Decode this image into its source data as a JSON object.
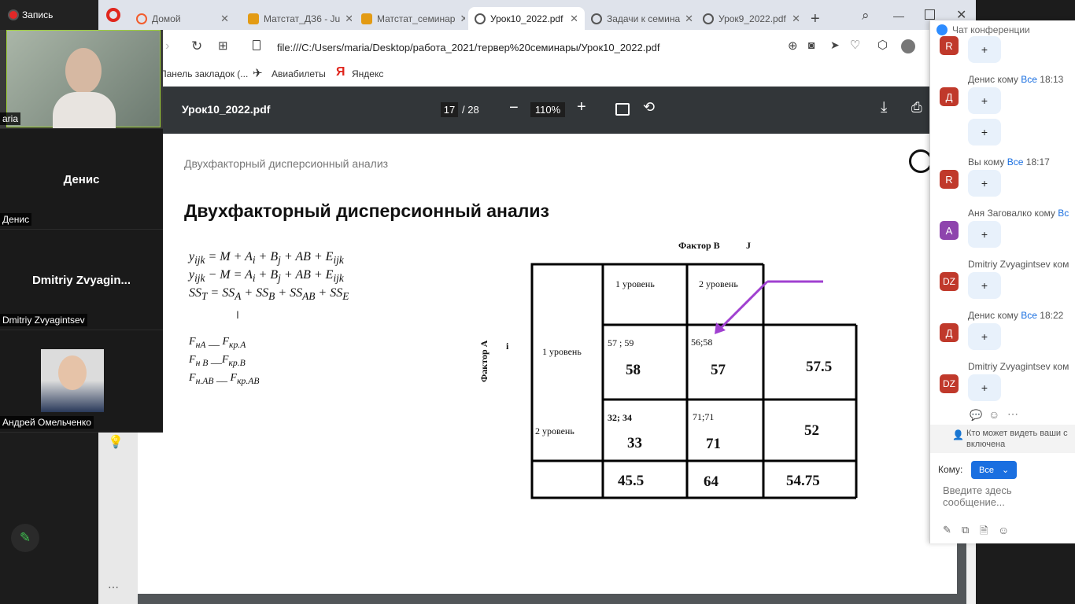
{
  "zoom": {
    "recording_label": "Запись",
    "participants": [
      {
        "name": "aria",
        "display": ""
      },
      {
        "name": "Денис",
        "display": "Денис"
      },
      {
        "name": "Dmitriy Zvyagintsev",
        "display": "Dmitriy  Zvyagin..."
      },
      {
        "name": "Андрей Омельченко",
        "display": ""
      }
    ]
  },
  "browser": {
    "tabs": [
      {
        "label": "Домой",
        "icon": "opera-icon"
      },
      {
        "label": "Матстат_ДЗ6 - Ju",
        "icon": "notebook-icon"
      },
      {
        "label": "Матстат_семинар",
        "icon": "notebook-icon"
      },
      {
        "label": "Урок10_2022.pdf",
        "icon": "globe-icon"
      },
      {
        "label": "Задачи к семина",
        "icon": "globe-icon"
      },
      {
        "label": "Урок9_2022.pdf",
        "icon": "globe-icon"
      }
    ],
    "url": "file:///C:/Users/maria/Desktop/работа_2021/тервер%20семинары/Урок10_2022.pdf",
    "bookmarks": [
      "Панель закладок (...",
      "Авиабилеты",
      "Яндекс"
    ]
  },
  "pdf": {
    "filename": "Урок10_2022.pdf",
    "page_current": "17",
    "page_total": "/ 28",
    "zoom": "110%"
  },
  "slide": {
    "subtitle": "Двухфакторный дисперсионный анализ",
    "title": "Двухфакторный дисперсионный анализ",
    "table": {
      "factor_b": "Фактор В",
      "factor_b_index": "J",
      "factor_a": "Фактор А",
      "factor_a_index": "i",
      "col1": "1 уровень",
      "col2": "2 уровень",
      "row1": "1 уровень",
      "row2": "2 уровень",
      "c11_small": "57 ; 59",
      "c11_big": "58",
      "c12_small": "56;58",
      "c12_big": "57",
      "r1_mean": "57.5",
      "c21_small": "32; 34",
      "c21_big": "33",
      "c22_small": "71;71",
      "c22_big": "71",
      "r2_mean": "52",
      "col1_mean": "45.5",
      "col2_mean": "64",
      "grand_mean": "54.75"
    }
  },
  "chat": {
    "title": "Чат конференции",
    "messages": [
      {
        "avatar": "R",
        "color": "#c0392b",
        "sender": "",
        "to": "",
        "time": "",
        "bubbles": [
          "+"
        ]
      },
      {
        "avatar": "Д",
        "color": "#c0392b",
        "sender": "Денис кому ",
        "to": "Все",
        "time": " 18:13",
        "bubbles": [
          "+",
          "+"
        ]
      },
      {
        "avatar": "R",
        "color": "#c0392b",
        "sender": "Вы кому ",
        "to": "Все",
        "time": " 18:17",
        "bubbles": [
          "+"
        ]
      },
      {
        "avatar": "A",
        "color": "#8e44ad",
        "sender": "Аня Заговалко кому ",
        "to": "Вс",
        "time": "",
        "bubbles": [
          "+"
        ]
      },
      {
        "avatar": "DZ",
        "color": "#c0392b",
        "sender": "Dmitriy Zvyagintsev ком",
        "to": "",
        "time": "",
        "bubbles": [
          "+"
        ]
      },
      {
        "avatar": "Д",
        "color": "#c0392b",
        "sender": "Денис кому ",
        "to": "Все",
        "time": " 18:22",
        "bubbles": [
          "+"
        ]
      },
      {
        "avatar": "DZ",
        "color": "#c0392b",
        "sender": "Dmitriy Zvyagintsev ком",
        "to": "",
        "time": "",
        "bubbles": [
          "+"
        ]
      }
    ],
    "notice": "Кто может видеть ваши с включена",
    "to_label": "Кому:",
    "to_value": "Все",
    "input_placeholder": "Введите здесь сообщение..."
  }
}
